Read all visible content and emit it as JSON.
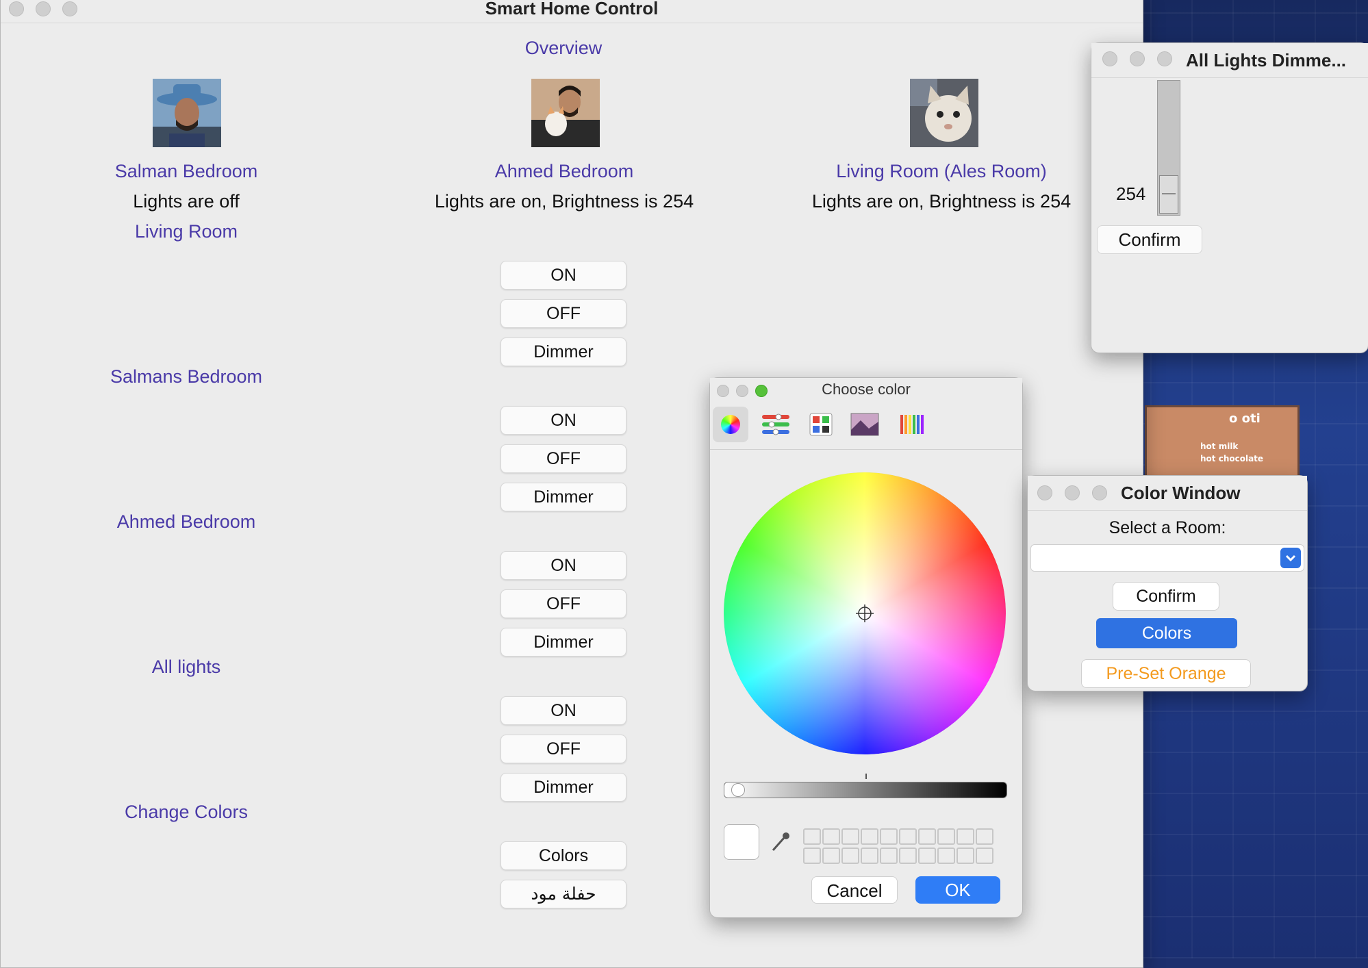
{
  "main": {
    "title": "Smart Home Control",
    "overview": "Overview",
    "rooms": [
      {
        "name": "Salman Bedroom",
        "status": "Lights are off"
      },
      {
        "name": "Ahmed Bedroom",
        "status": "Lights are on, Brightness is 254"
      },
      {
        "name": "Living Room (Ales Room)",
        "status": "Lights are on, Brightness is 254"
      }
    ],
    "sections": {
      "living_room": "Living Room",
      "salmans_bedroom": "Salmans Bedroom",
      "ahmed_bedroom": "Ahmed Bedroom",
      "all_lights": "All lights",
      "change_colors": "Change Colors"
    },
    "buttons": {
      "on": "ON",
      "off": "OFF",
      "dimmer": "Dimmer",
      "colors": "Colors",
      "party": "حفلة مود"
    }
  },
  "picker": {
    "title": "Choose color",
    "cancel": "Cancel",
    "ok": "OK",
    "brightness_level": 0.02,
    "selected_color": "#ffffff"
  },
  "dimmer": {
    "title": "All Lights Dimme...",
    "value": "254",
    "confirm": "Confirm"
  },
  "color_window": {
    "title": "Color Window",
    "select_label": "Select a Room:",
    "select_value": "",
    "confirm": "Confirm",
    "colors": "Colors",
    "preset": "Pre-Set Orange",
    "preset_color": "#f39a1e",
    "accent": "#2f72e2"
  },
  "background_sign": {
    "brand": "o oti",
    "line1": "hot milk",
    "line2": "hot chocolate"
  }
}
